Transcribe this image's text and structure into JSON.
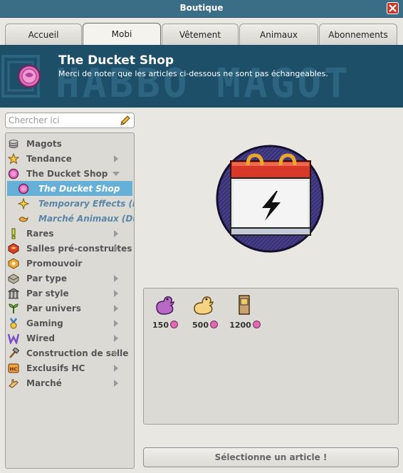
{
  "window": {
    "title": "Boutique"
  },
  "tabs": [
    {
      "label": "Accueil"
    },
    {
      "label": "Mobi",
      "active": true
    },
    {
      "label": "Vêtement"
    },
    {
      "label": "Animaux"
    },
    {
      "label": "Abonnements"
    }
  ],
  "banner": {
    "bg_text": "HABBO MAGOT",
    "title": "The Ducket Shop",
    "description": "Merci de noter que les articles ci-dessous ne sont pas échangeables."
  },
  "search": {
    "placeholder": "Chercher ici"
  },
  "categories": [
    {
      "label": "Magots",
      "icon": "coins-icon"
    },
    {
      "label": "Tendance",
      "icon": "star-icon",
      "arrow": "right"
    },
    {
      "label": "The Ducket Shop",
      "icon": "ducket-icon",
      "arrow": "down"
    },
    {
      "label": "The Ducket Shop",
      "icon": "ducket-icon",
      "sub": true,
      "selected": true
    },
    {
      "label": "Temporary Effects (Duc",
      "icon": "effect-icon",
      "sub": true
    },
    {
      "label": "Marché Animaux (Ducke",
      "icon": "pet-icon",
      "sub": true
    },
    {
      "label": "Rares",
      "icon": "exclamation-icon",
      "arrow": "right"
    },
    {
      "label": "Salles pré-construites",
      "icon": "room-icon",
      "arrow": "right"
    },
    {
      "label": "Promouvoir",
      "icon": "promote-icon"
    },
    {
      "label": "Par type",
      "icon": "type-icon",
      "arrow": "right"
    },
    {
      "label": "Par style",
      "icon": "style-icon",
      "arrow": "right"
    },
    {
      "label": "Par univers",
      "icon": "plant-icon",
      "arrow": "right"
    },
    {
      "label": "Gaming",
      "icon": "medal-icon",
      "arrow": "right"
    },
    {
      "label": "Wired",
      "icon": "wired-icon",
      "arrow": "right"
    },
    {
      "label": "Construction de salle",
      "icon": "hammer-icon",
      "arrow": "right"
    },
    {
      "label": "Exclusifs HC",
      "icon": "hc-icon",
      "arrow": "right"
    },
    {
      "label": "Marché",
      "icon": "hand-icon",
      "arrow": "right"
    }
  ],
  "items": [
    {
      "price": "150",
      "icon": "rubber-duck-icon"
    },
    {
      "price": "500",
      "icon": "gold-duck-icon"
    },
    {
      "price": "1200",
      "icon": "cabinet-icon"
    }
  ],
  "footer": {
    "select_label": "Sélectionne un article !"
  },
  "colors": {
    "accent": "#66b0d8",
    "banner": "#1e4f68",
    "close": "#c83a27"
  }
}
